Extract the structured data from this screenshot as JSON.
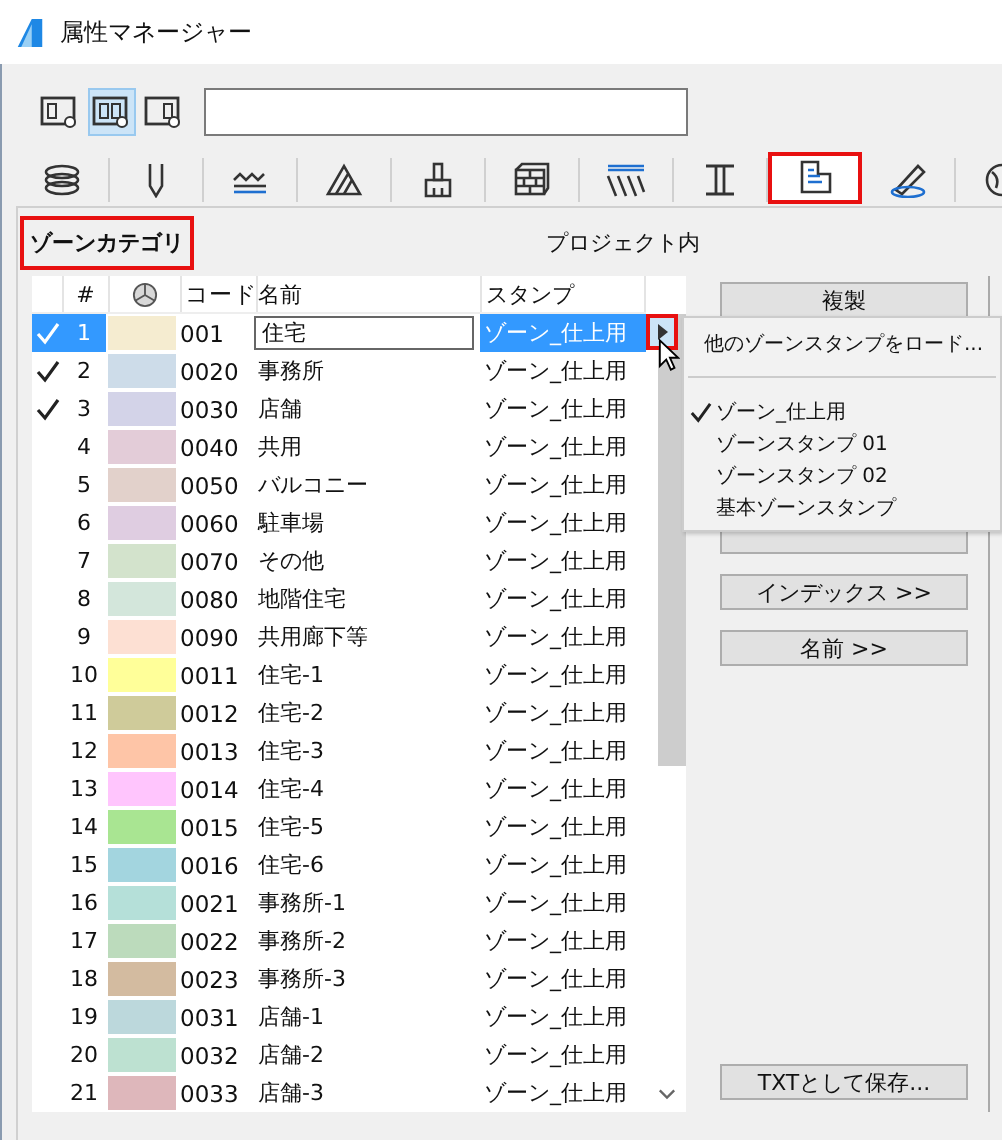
{
  "window": {
    "title": "属性マネージャー"
  },
  "view_buttons": [
    {
      "selected": false
    },
    {
      "selected": true
    },
    {
      "selected": false
    }
  ],
  "tabs": [
    {
      "kind": "layers",
      "selected": false,
      "highlighted": false
    },
    {
      "kind": "pen",
      "selected": false,
      "highlighted": false
    },
    {
      "kind": "line",
      "selected": false,
      "highlighted": false
    },
    {
      "kind": "hatch",
      "selected": false,
      "highlighted": false
    },
    {
      "kind": "brush",
      "selected": false,
      "highlighted": false
    },
    {
      "kind": "brick",
      "selected": false,
      "highlighted": false
    },
    {
      "kind": "stripes",
      "selected": false,
      "highlighted": false
    },
    {
      "kind": "ibeam",
      "selected": false,
      "highlighted": false
    },
    {
      "kind": "zone",
      "selected": true,
      "highlighted": true
    },
    {
      "kind": "pencil",
      "selected": false,
      "highlighted": false
    },
    {
      "kind": "globe",
      "selected": false,
      "highlighted": false
    }
  ],
  "panel": {
    "category_label": "ゾーンカテゴリ",
    "category_highlighted": true,
    "column_label": "プロジェクト内"
  },
  "table": {
    "headers": {
      "number": "#",
      "code": "コード",
      "name": "名前",
      "stamp": "スタンプ"
    },
    "rows": [
      {
        "checked": true,
        "selected": true,
        "number": "1",
        "color": "#f5ecd0",
        "code": "001",
        "name": "住宅",
        "stamp": "ゾーン_仕上用"
      },
      {
        "checked": true,
        "selected": false,
        "number": "2",
        "color": "#cddce9",
        "code": "0020",
        "name": "事務所",
        "stamp": "ゾーン_仕上用"
      },
      {
        "checked": true,
        "selected": false,
        "number": "3",
        "color": "#d3d3e8",
        "code": "0030",
        "name": "店舗",
        "stamp": "ゾーン_仕上用"
      },
      {
        "checked": false,
        "selected": false,
        "number": "4",
        "color": "#e3ccd8",
        "code": "0040",
        "name": "共用",
        "stamp": "ゾーン_仕上用"
      },
      {
        "checked": false,
        "selected": false,
        "number": "5",
        "color": "#e2d1cb",
        "code": "0050",
        "name": "バルコニー",
        "stamp": "ゾーン_仕上用"
      },
      {
        "checked": false,
        "selected": false,
        "number": "6",
        "color": "#dfcde1",
        "code": "0060",
        "name": "駐車場",
        "stamp": "ゾーン_仕上用"
      },
      {
        "checked": false,
        "selected": false,
        "number": "7",
        "color": "#d3e3cc",
        "code": "0070",
        "name": "その他",
        "stamp": "ゾーン_仕上用"
      },
      {
        "checked": false,
        "selected": false,
        "number": "8",
        "color": "#d3e6db",
        "code": "0080",
        "name": "地階住宅",
        "stamp": "ゾーン_仕上用"
      },
      {
        "checked": false,
        "selected": false,
        "number": "9",
        "color": "#fde0d3",
        "code": "0090",
        "name": "共用廊下等",
        "stamp": "ゾーン_仕上用"
      },
      {
        "checked": false,
        "selected": false,
        "number": "10",
        "color": "#ffff99",
        "code": "0011",
        "name": "住宅-1",
        "stamp": "ゾーン_仕上用"
      },
      {
        "checked": false,
        "selected": false,
        "number": "11",
        "color": "#cfcb9a",
        "code": "0012",
        "name": "住宅-2",
        "stamp": "ゾーン_仕上用"
      },
      {
        "checked": false,
        "selected": false,
        "number": "12",
        "color": "#fec5a7",
        "code": "0013",
        "name": "住宅-3",
        "stamp": "ゾーン_仕上用"
      },
      {
        "checked": false,
        "selected": false,
        "number": "13",
        "color": "#ffc5fd",
        "code": "0014",
        "name": "住宅-4",
        "stamp": "ゾーン_仕上用"
      },
      {
        "checked": false,
        "selected": false,
        "number": "14",
        "color": "#a9e592",
        "code": "0015",
        "name": "住宅-5",
        "stamp": "ゾーン_仕上用"
      },
      {
        "checked": false,
        "selected": false,
        "number": "15",
        "color": "#a3d5df",
        "code": "0016",
        "name": "住宅-6",
        "stamp": "ゾーン_仕上用"
      },
      {
        "checked": false,
        "selected": false,
        "number": "16",
        "color": "#b5e0d9",
        "code": "0021",
        "name": "事務所-1",
        "stamp": "ゾーン_仕上用"
      },
      {
        "checked": false,
        "selected": false,
        "number": "17",
        "color": "#bcdbbc",
        "code": "0022",
        "name": "事務所-2",
        "stamp": "ゾーン_仕上用"
      },
      {
        "checked": false,
        "selected": false,
        "number": "18",
        "color": "#d3bba0",
        "code": "0023",
        "name": "事務所-3",
        "stamp": "ゾーン_仕上用"
      },
      {
        "checked": false,
        "selected": false,
        "number": "19",
        "color": "#bcd8dc",
        "code": "0031",
        "name": "店舗-1",
        "stamp": "ゾーン_仕上用"
      },
      {
        "checked": false,
        "selected": false,
        "number": "20",
        "color": "#bde1d1",
        "code": "0032",
        "name": "店舗-2",
        "stamp": "ゾーン_仕上用"
      },
      {
        "checked": false,
        "selected": false,
        "number": "21",
        "color": "#deb7bb",
        "code": "0033",
        "name": "店舗-3",
        "stamp": "ゾーン_仕上用"
      }
    ]
  },
  "stamp_menu": {
    "button_highlighted": true,
    "load_item": "他のゾーンスタンプをロード...",
    "items": [
      {
        "label": "ゾーン_仕上用",
        "checked": true
      },
      {
        "label": "ゾーンスタンプ 01",
        "checked": false
      },
      {
        "label": "ゾーンスタンプ 02",
        "checked": false
      },
      {
        "label": "基本ゾーンスタンプ",
        "checked": false
      }
    ]
  },
  "buttons": [
    {
      "label": "複製"
    },
    {
      "label": "インデックス >>"
    },
    {
      "label": "名前 >>"
    }
  ],
  "save_button": {
    "label": "TXTとして保存..."
  }
}
